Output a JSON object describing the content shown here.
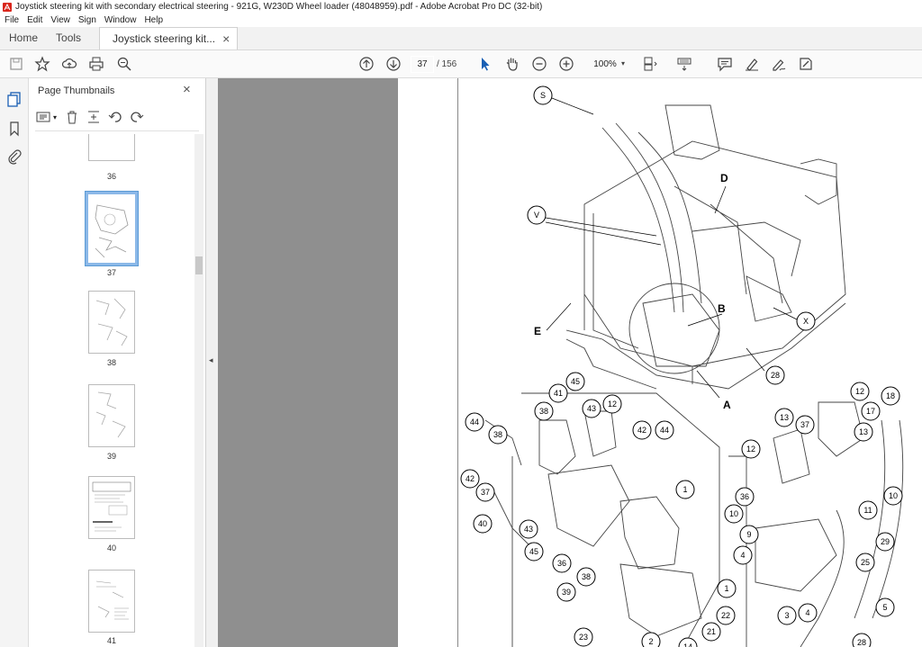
{
  "window": {
    "title": "Joystick steering kit with secondary electrical steering - 921G, W230D Wheel loader (48048959).pdf - Adobe Acrobat Pro DC (32-bit)"
  },
  "menu": [
    "File",
    "Edit",
    "View",
    "Sign",
    "Window",
    "Help"
  ],
  "tabs": {
    "home": "Home",
    "tools": "Tools",
    "document": "Joystick steering kit...",
    "close": "×"
  },
  "toolbar": {
    "current_page": "37",
    "total_pages": "/ 156",
    "zoom": "100%"
  },
  "panel": {
    "title": "Page Thumbnails",
    "close": "×",
    "thumbnails": [
      {
        "label": "36",
        "selected": false
      },
      {
        "label": "37",
        "selected": true
      },
      {
        "label": "38",
        "selected": false
      },
      {
        "label": "39",
        "selected": false
      },
      {
        "label": "40",
        "selected": false
      },
      {
        "label": "41",
        "selected": false
      }
    ]
  },
  "splitter": {
    "arrow": "◂"
  },
  "diagram": {
    "letters": [
      "S",
      "D",
      "V",
      "B",
      "E",
      "X",
      "A"
    ],
    "callouts": [
      "28",
      "45",
      "41",
      "43",
      "12",
      "38",
      "44",
      "42",
      "37",
      "40",
      "43",
      "45",
      "36",
      "38",
      "39",
      "1",
      "12",
      "13",
      "37",
      "12",
      "17",
      "18",
      "13",
      "36",
      "10",
      "9",
      "4",
      "11",
      "10",
      "29",
      "25",
      "1",
      "3",
      "4",
      "5",
      "21",
      "22",
      "2",
      "14",
      "23",
      "28",
      "38",
      "44",
      "42"
    ]
  }
}
